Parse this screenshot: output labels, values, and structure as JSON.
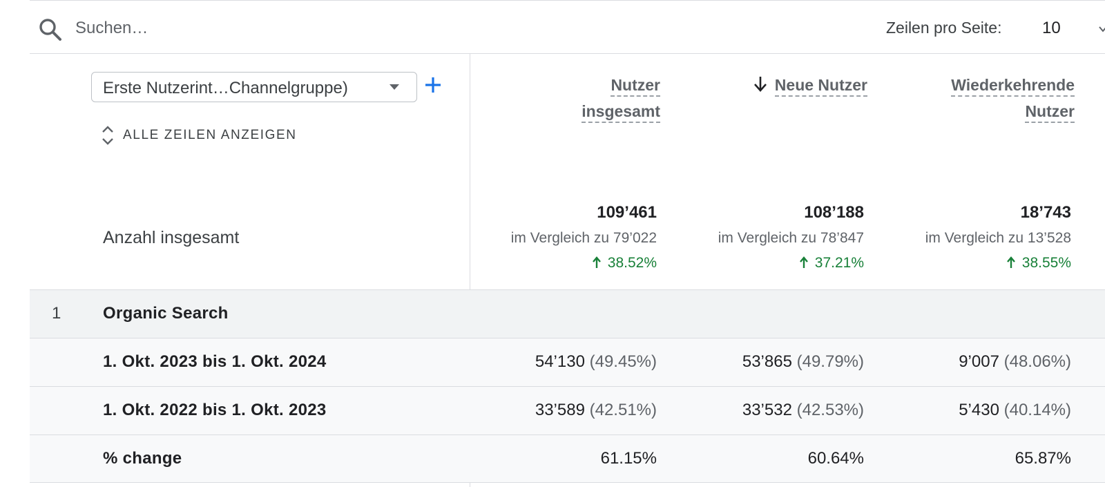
{
  "search": {
    "placeholder": "Suchen…"
  },
  "pagination": {
    "rows_label": "Zeilen pro Seite:",
    "rows_value": "10"
  },
  "dimension": {
    "label": "Erste Nutzerint…Channelgruppe)"
  },
  "show_all_label": "ALLE ZEILEN ANZEIGEN",
  "columns": [
    {
      "line1": "Nutzer",
      "line2": "insgesamt",
      "sorted": false
    },
    {
      "line1": "Neue Nutzer",
      "line2": "",
      "sorted": true
    },
    {
      "line1": "Wiederkehrende",
      "line2": "Nutzer",
      "sorted": false
    }
  ],
  "totals": {
    "label": "Anzahl insgesamt",
    "cells": [
      {
        "value": "109’461",
        "compare": "im Vergleich zu 79’022",
        "change": "38.52%"
      },
      {
        "value": "108’188",
        "compare": "im Vergleich zu 78’847",
        "change": "37.21%"
      },
      {
        "value": "18’743",
        "compare": "im Vergleich zu 13’528",
        "change": "38.55%"
      }
    ]
  },
  "rows": [
    {
      "index": "1",
      "label": "Organic Search",
      "values": []
    },
    {
      "index": "",
      "label": "1. Okt. 2023 bis 1. Okt. 2024",
      "values": [
        {
          "num": "54’130",
          "pct": "(49.45%)"
        },
        {
          "num": "53’865",
          "pct": "(49.79%)"
        },
        {
          "num": "9’007",
          "pct": "(48.06%)"
        }
      ]
    },
    {
      "index": "",
      "label": "1. Okt. 2022 bis 1. Okt. 2023",
      "values": [
        {
          "num": "33’589",
          "pct": "(42.51%)"
        },
        {
          "num": "33’532",
          "pct": "(42.53%)"
        },
        {
          "num": "5’430",
          "pct": "(40.14%)"
        }
      ]
    },
    {
      "index": "",
      "label": "% change",
      "values": [
        {
          "num": "61.15%",
          "pct": ""
        },
        {
          "num": "60.64%",
          "pct": ""
        },
        {
          "num": "65.87%",
          "pct": ""
        }
      ]
    }
  ],
  "colors": {
    "accent": "#1a73e8",
    "positive": "#188038",
    "divider": "#dadce0",
    "group_row": "#f1f3f4",
    "sub_row": "#f8f9fa"
  },
  "icons": [
    "search-icon",
    "chevron-down-icon",
    "dropdown-icon",
    "plus-icon",
    "expand-icon",
    "arrow-down-icon",
    "arrow-up-icon"
  ]
}
